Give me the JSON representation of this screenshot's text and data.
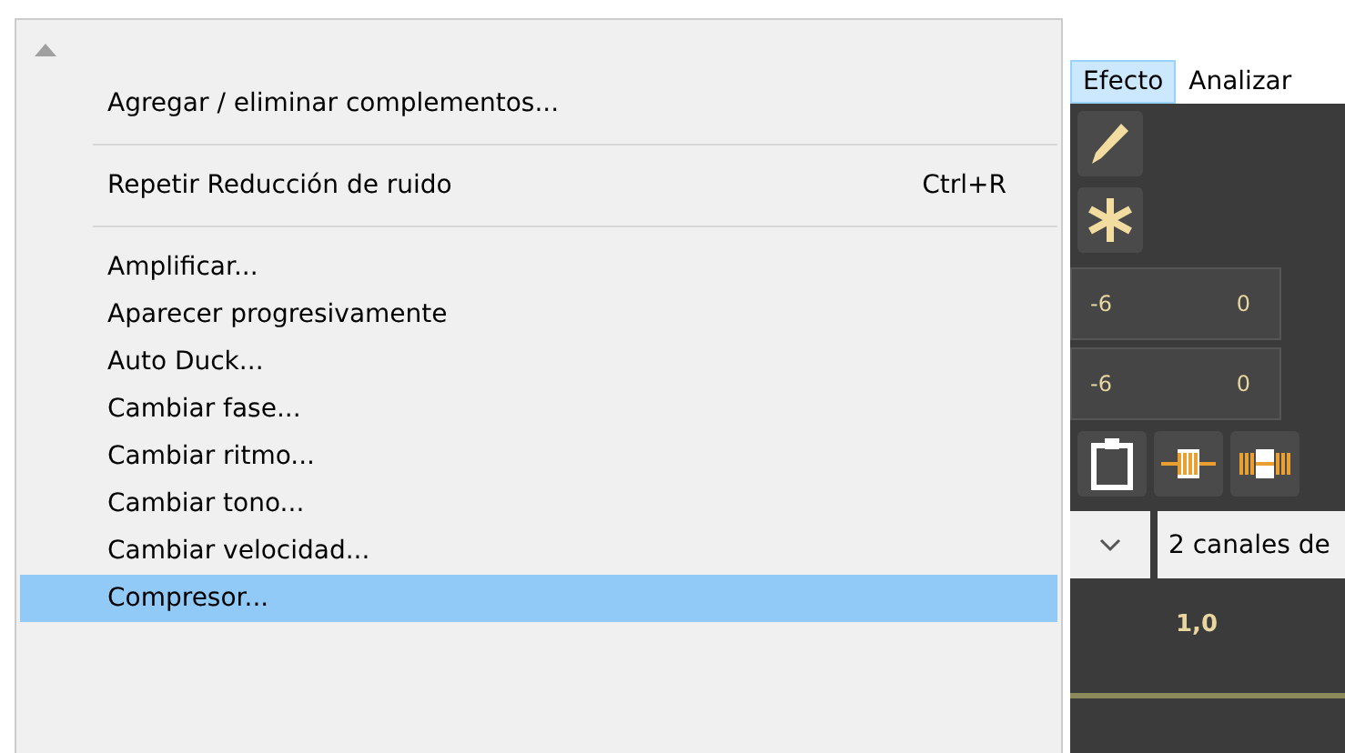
{
  "menu": {
    "items": [
      {
        "kind": "command",
        "label": "Agregar / eliminar complementos...",
        "selected": false
      },
      {
        "kind": "separator"
      },
      {
        "kind": "command",
        "label": "Repetir Reducción de ruido",
        "shortcut": "Ctrl+R",
        "selected": false
      },
      {
        "kind": "separator"
      },
      {
        "kind": "command",
        "label": "Amplificar...",
        "selected": false
      },
      {
        "kind": "command",
        "label": "Aparecer progresivamente",
        "selected": false
      },
      {
        "kind": "command",
        "label": "Auto Duck...",
        "selected": false
      },
      {
        "kind": "command",
        "label": "Cambiar fase...",
        "selected": false
      },
      {
        "kind": "command",
        "label": "Cambiar ritmo...",
        "selected": false
      },
      {
        "kind": "command",
        "label": "Cambiar tono...",
        "selected": false
      },
      {
        "kind": "command",
        "label": "Cambiar velocidad...",
        "selected": false
      },
      {
        "kind": "command",
        "label": "Compresor...",
        "selected": true
      }
    ]
  },
  "menubar": [
    {
      "label": "Efecto",
      "selected": true
    },
    {
      "label": "Analizar",
      "selected": false
    }
  ],
  "meters": [
    {
      "labels": [
        "-6",
        "0"
      ]
    },
    {
      "labels": [
        "-6",
        "0"
      ]
    }
  ],
  "channels_field": {
    "value": "2 canales de"
  },
  "timeline": {
    "label": "1,0"
  }
}
